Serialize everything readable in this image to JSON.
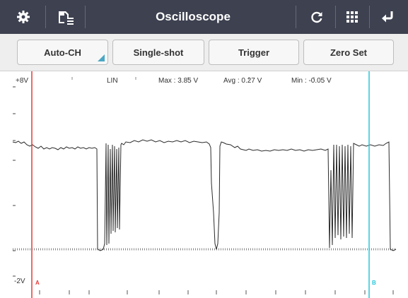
{
  "toolbar": {
    "title": "Oscilloscope",
    "icons": [
      "gear-icon",
      "save-icon",
      "refresh-icon",
      "grid-icon",
      "return-icon"
    ]
  },
  "buttons": {
    "auto_ch": "Auto-CH",
    "single_shot": "Single-shot",
    "trigger": "Trigger",
    "zero_set": "Zero Set"
  },
  "scope": {
    "channel": "LIN",
    "max": "Max : 3.85 V",
    "avg": "Avg : 0.27 V",
    "min": "Min : -0.05 V",
    "y_top": "+8V",
    "y_bottom": "-2V",
    "cursor_a": "A",
    "cursor_b": "B",
    "cursor_a_color": "#e53935",
    "cursor_b_color": "#26c6da"
  }
}
